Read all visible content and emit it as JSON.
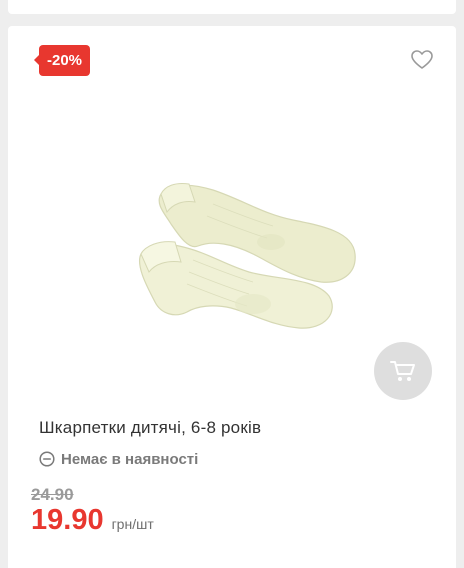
{
  "product": {
    "discount_badge": "-20%",
    "title": "Шкарпетки дитячі, 6-8 років",
    "stock_status": "Немає в наявності",
    "old_price": "24.90",
    "price": "19.90",
    "unit": "грн/шт",
    "image_icon": "socks-image",
    "wishlist_icon": "heart-icon",
    "cart_icon": "cart-icon",
    "stock_icon": "minus-circle-icon"
  },
  "colors": {
    "accent": "#e8372f",
    "muted": "#7a7a7a",
    "cart_bg": "#dedede",
    "sock": "#eff0d4"
  }
}
